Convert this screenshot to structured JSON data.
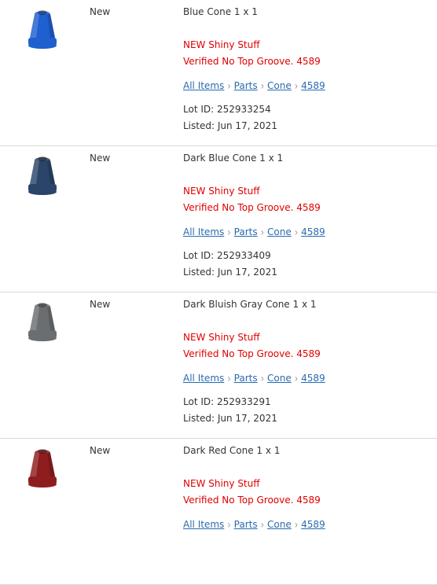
{
  "listings": [
    {
      "condition": "New",
      "title": "Blue Cone 1 x 1",
      "note1": "NEW Shiny Stuff",
      "note2": "Verified No Top Groove. 4589",
      "breadcrumb": [
        "All Items",
        "Parts",
        "Cone",
        "4589"
      ],
      "lot": "Lot ID: 252933254",
      "listed": "Listed: Jun 17, 2021",
      "color": "#1f5fcf"
    },
    {
      "condition": "New",
      "title": "Dark Blue Cone 1 x 1",
      "note1": "NEW Shiny Stuff",
      "note2": "Verified No Top Groove. 4589",
      "breadcrumb": [
        "All Items",
        "Parts",
        "Cone",
        "4589"
      ],
      "lot": "Lot ID: 252933409",
      "listed": "Listed: Jun 17, 2021",
      "color": "#2a4569"
    },
    {
      "condition": "New",
      "title": "Dark Bluish Gray Cone 1 x 1",
      "note1": "NEW Shiny Stuff",
      "note2": "Verified No Top Groove. 4589",
      "breadcrumb": [
        "All Items",
        "Parts",
        "Cone",
        "4589"
      ],
      "lot": "Lot ID: 252933291",
      "listed": "Listed: Jun 17, 2021",
      "color": "#6b6e70"
    },
    {
      "condition": "New",
      "title": "Dark Red Cone 1 x 1",
      "note1": "NEW Shiny Stuff",
      "note2": "Verified No Top Groove. 4589",
      "breadcrumb": [
        "All Items",
        "Parts",
        "Cone",
        "4589"
      ],
      "color": "#8f1d1d"
    }
  ]
}
